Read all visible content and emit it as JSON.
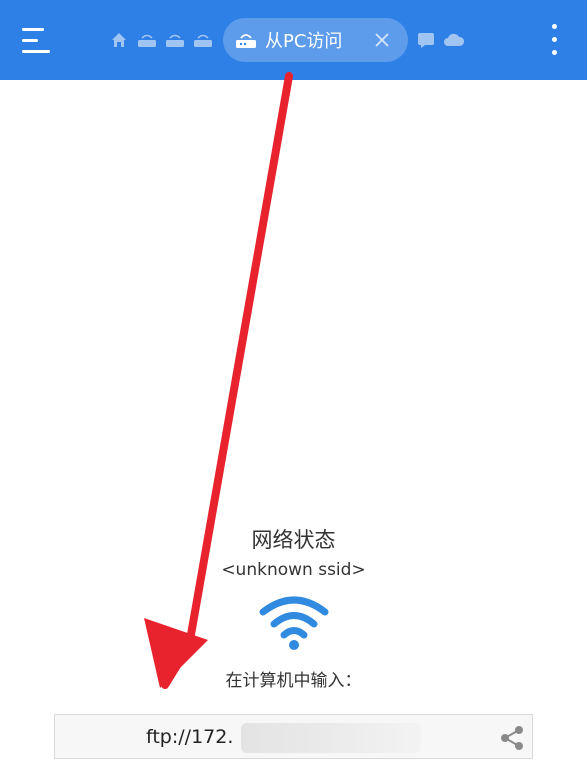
{
  "header": {
    "active_tab_label": "从PC访问",
    "background_color": "#2f80e6"
  },
  "tabs": [
    {
      "icon": "home-icon"
    },
    {
      "icon": "router-icon"
    },
    {
      "icon": "router-icon"
    },
    {
      "icon": "router-icon"
    },
    {
      "icon": "router-icon",
      "active": true
    },
    {
      "icon": "message-icon"
    },
    {
      "icon": "cloud-icon"
    }
  ],
  "main": {
    "status_title": "网络状态",
    "ssid": "<unknown ssid>",
    "enter_prompt": "在计算机中输入：",
    "url_prefix": "ftp://172."
  },
  "annotation": {
    "arrow_color": "#e8232e"
  },
  "accent_colors": {
    "wifi": "#2f8ae0"
  }
}
